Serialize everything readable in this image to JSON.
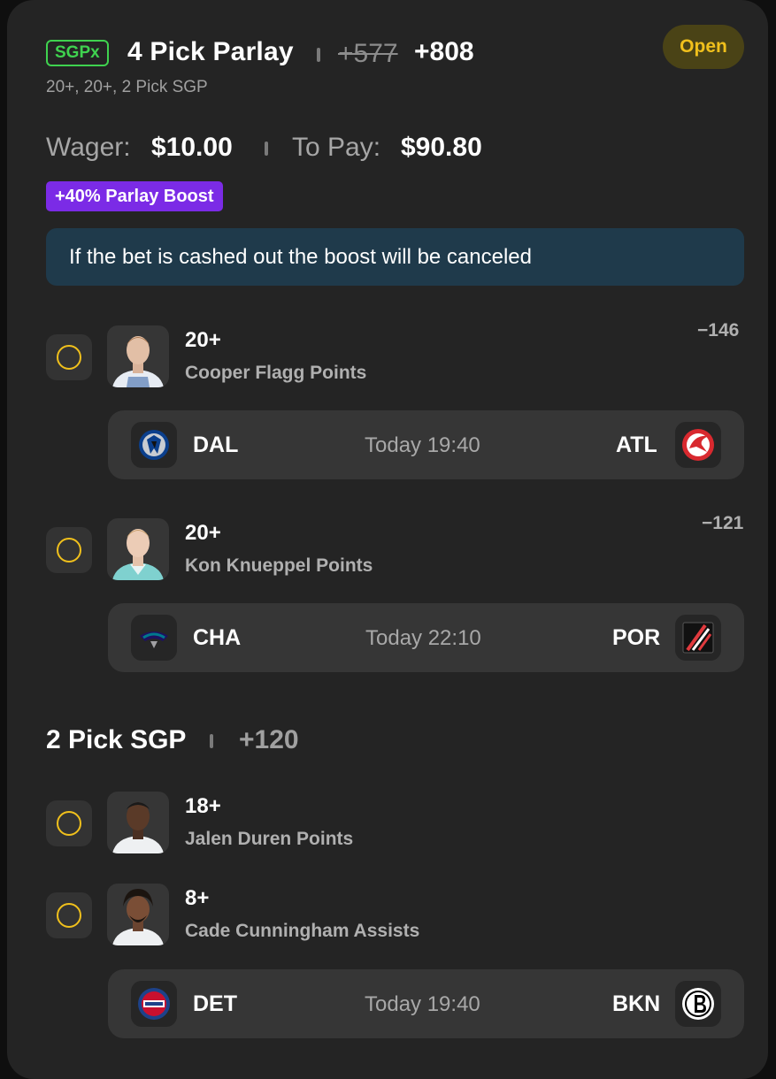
{
  "bet": {
    "tag": "SGPx",
    "title": "4 Pick Parlay",
    "old_odds": "+577",
    "new_odds": "+808",
    "subtitle": "20+, 20+, 2 Pick SGP",
    "status": "Open",
    "wager_label": "Wager:",
    "wager_value": "$10.00",
    "topay_label": "To Pay:",
    "topay_value": "$90.80",
    "boost": "+40% Parlay Boost",
    "notice": "If the bet is cashed out the boost will be canceled"
  },
  "legs": [
    {
      "line": "20+",
      "player": "Cooper Flagg Points",
      "odds": "−146",
      "jersey_color": "#e7ecf3"
    },
    {
      "line": "20+",
      "player": "Kon Knueppel Points",
      "odds": "−121",
      "jersey_color": "#7fd1cf"
    },
    {
      "line": "18+",
      "player": "Jalen Duren Points"
    },
    {
      "line": "8+",
      "player": "Cade Cunningham Assists"
    }
  ],
  "games": [
    {
      "home": "DAL",
      "time": "Today 19:40",
      "away": "ATL",
      "home_icon": "mavericks-logo-icon",
      "away_icon": "hawks-logo-icon"
    },
    {
      "home": "CHA",
      "time": "Today 22:10",
      "away": "POR",
      "home_icon": "hornets-logo-icon",
      "away_icon": "blazers-logo-icon"
    },
    {
      "home": "DET",
      "time": "Today 19:40",
      "away": "BKN",
      "home_icon": "pistons-logo-icon",
      "away_icon": "nets-logo-icon"
    }
  ],
  "sgp": {
    "title": "2 Pick SGP",
    "odds": "+120"
  },
  "colors": {
    "accent_yellow": "#f0c01c",
    "sgpx_green": "#3fd24f",
    "boost_purple": "#7b2be6",
    "notice_bg": "#1f3a4b"
  }
}
